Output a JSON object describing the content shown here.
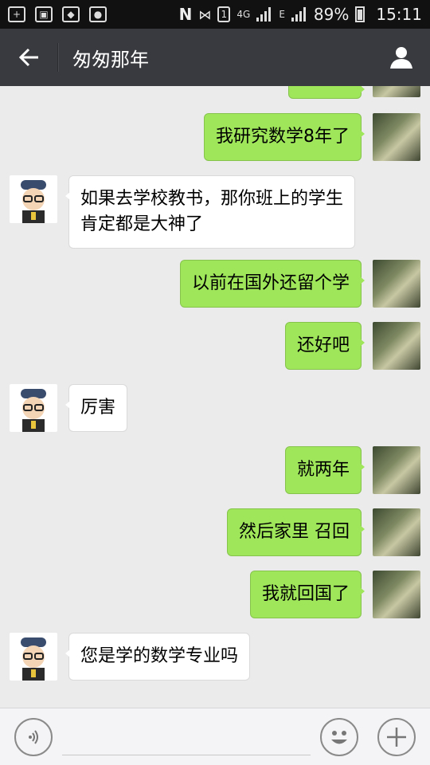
{
  "status_bar": {
    "network": "4G",
    "network_sub": "E",
    "battery": "89%",
    "time": "15:11",
    "sim": "1"
  },
  "header": {
    "title": "匆匆那年"
  },
  "messages": [
    {
      "from": "me",
      "text": "我研究数学8年了"
    },
    {
      "from": "them",
      "text_lines": [
        "如果去学校教书，那你班上的学生",
        "肯定都是大神了"
      ]
    },
    {
      "from": "me",
      "text": "以前在国外还留个学"
    },
    {
      "from": "me",
      "text": "还好吧"
    },
    {
      "from": "them",
      "text": "厉害"
    },
    {
      "from": "me",
      "text": "就两年"
    },
    {
      "from": "me",
      "text": "然后家里 召回"
    },
    {
      "from": "me",
      "text": "我就回国了"
    },
    {
      "from": "them",
      "text": "您是学的数学专业吗"
    }
  ],
  "colors": {
    "title_bar": "#393a3f",
    "my_bubble": "#9fe65b",
    "their_bubble": "#ffffff",
    "chat_bg": "#ebebeb"
  }
}
